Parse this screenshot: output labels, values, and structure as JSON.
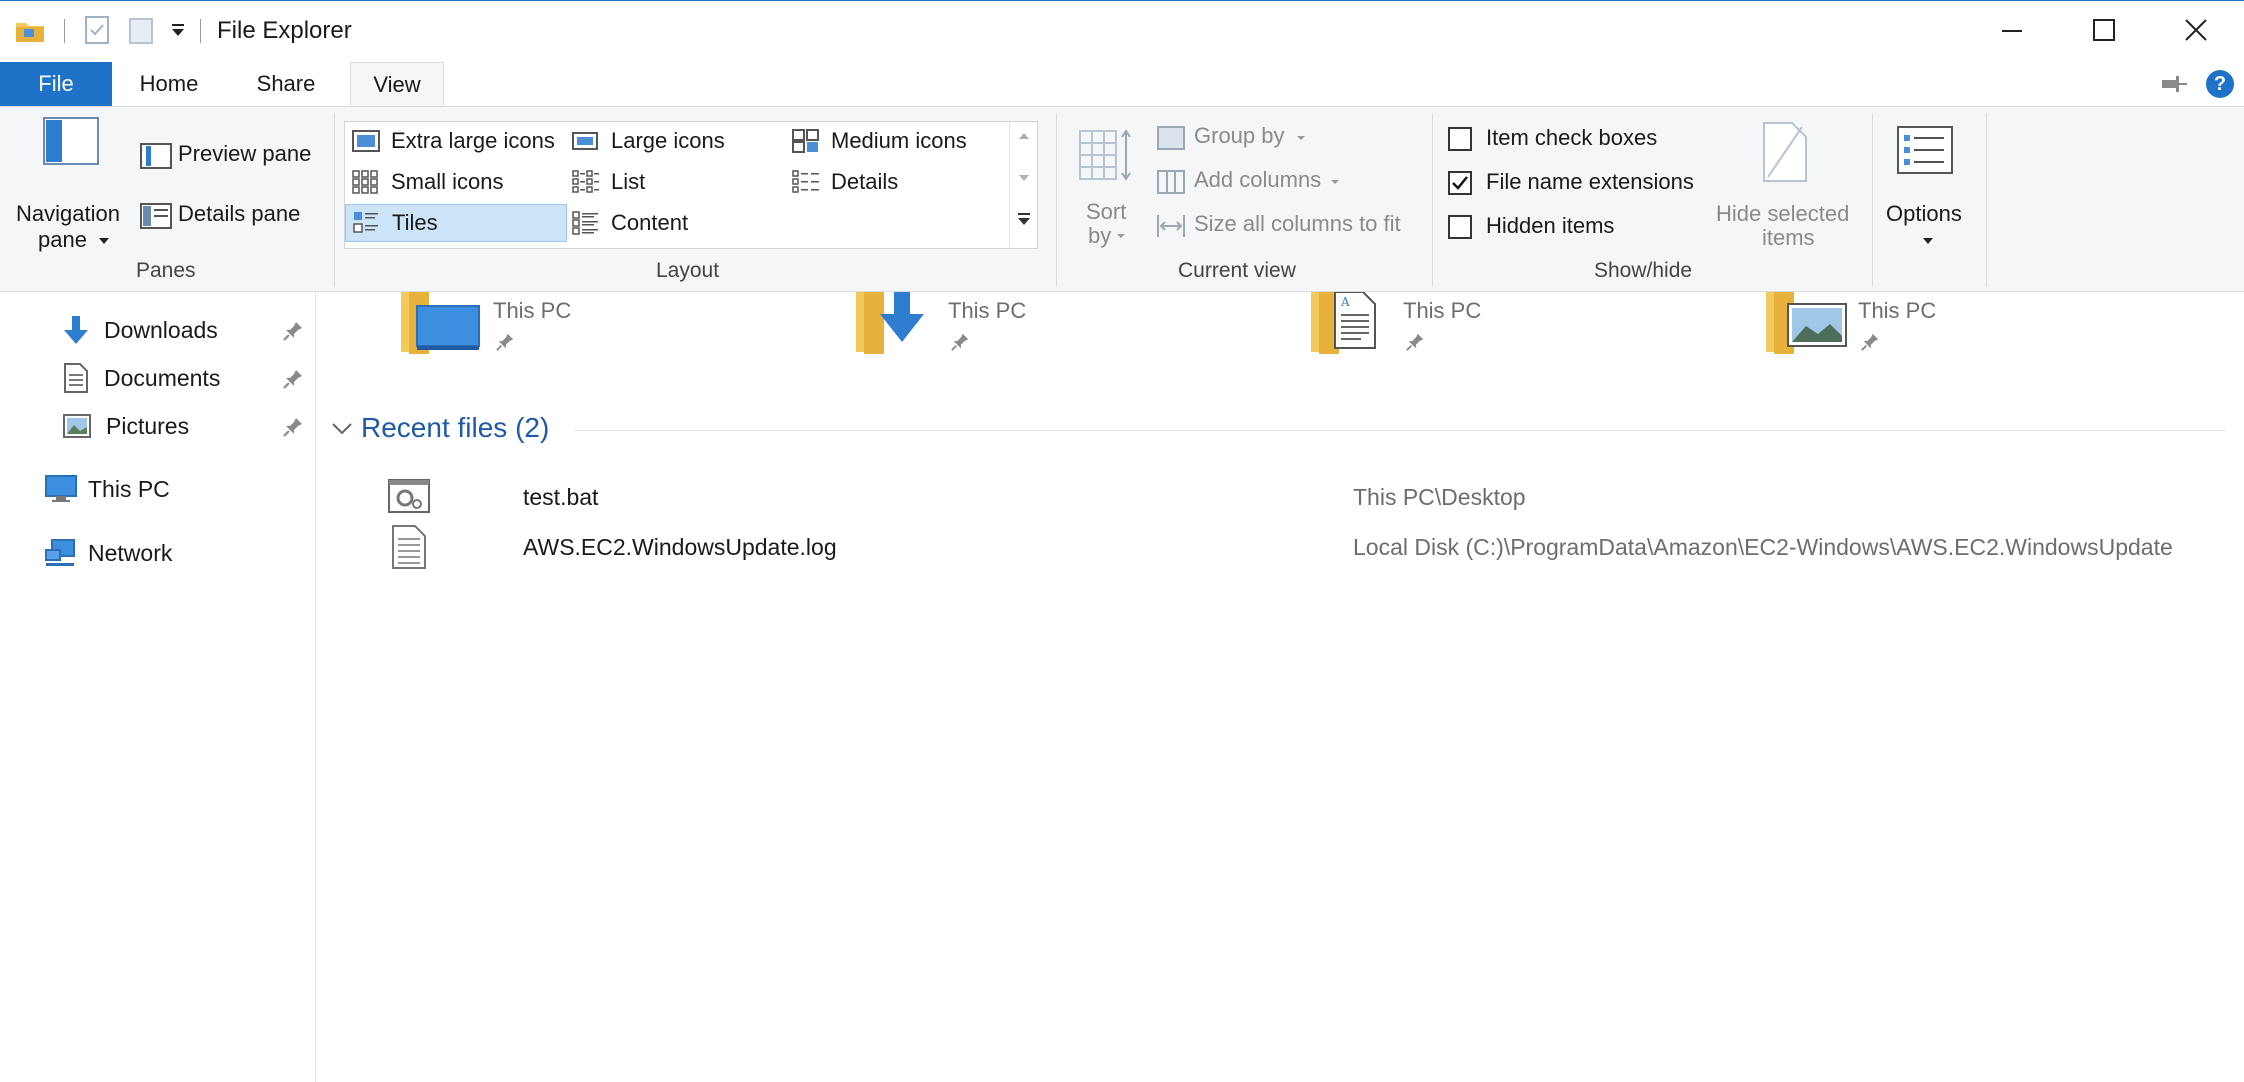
{
  "window": {
    "title": "File Explorer",
    "quick_access_toolbar": [
      "folder-icon",
      "properties-icon",
      "new-folder-icon",
      "customize-dropdown-icon"
    ],
    "controls": [
      "minimize",
      "maximize",
      "close"
    ]
  },
  "ribbon_tabs": [
    {
      "label": "File"
    },
    {
      "label": "Home"
    },
    {
      "label": "Share"
    },
    {
      "label": "View",
      "active": true
    }
  ],
  "ribbon": {
    "panes": {
      "group_label": "Panes",
      "navigation_pane_line1": "Navigation",
      "navigation_pane_line2": "pane",
      "preview_pane": "Preview pane",
      "details_pane": "Details pane"
    },
    "layout": {
      "group_label": "Layout",
      "items": [
        {
          "label": "Extra large icons"
        },
        {
          "label": "Large icons"
        },
        {
          "label": "Medium icons"
        },
        {
          "label": "Small icons"
        },
        {
          "label": "List"
        },
        {
          "label": "Details"
        },
        {
          "label": "Tiles",
          "selected": true
        },
        {
          "label": "Content"
        }
      ]
    },
    "current_view": {
      "group_label": "Current view",
      "sort_by_line1": "Sort",
      "sort_by_line2": "by",
      "group_by": "Group by",
      "add_columns": "Add columns",
      "size_all_columns": "Size all columns to fit"
    },
    "show_hide": {
      "group_label": "Show/hide",
      "item_check_boxes": {
        "label": "Item check boxes",
        "checked": false
      },
      "file_name_extensions": {
        "label": "File name extensions",
        "checked": true
      },
      "hidden_items": {
        "label": "Hidden items",
        "checked": false
      },
      "hide_selected_line1": "Hide selected",
      "hide_selected_line2": "items"
    },
    "options": {
      "label": "Options"
    }
  },
  "nav_pane": {
    "items": [
      {
        "label": "Downloads",
        "pinned": true
      },
      {
        "label": "Documents",
        "pinned": true
      },
      {
        "label": "Pictures",
        "pinned": true
      },
      {
        "label": "This PC"
      },
      {
        "label": "Network"
      }
    ]
  },
  "quick_access_tiles": [
    {
      "location": "This PC",
      "icon": "desktop-folder-icon"
    },
    {
      "location": "This PC",
      "icon": "downloads-folder-icon"
    },
    {
      "location": "This PC",
      "icon": "documents-folder-icon"
    },
    {
      "location": "This PC",
      "icon": "pictures-folder-icon"
    }
  ],
  "recent_files": {
    "title": "Recent files (2)",
    "items": [
      {
        "name": "test.bat",
        "location": "This PC\\Desktop",
        "icon": "batch-file-icon"
      },
      {
        "name": "AWS.EC2.WindowsUpdate.log",
        "location": "Local Disk (C:)\\ProgramData\\Amazon\\EC2-Windows\\AWS.EC2.WindowsUpdate",
        "icon": "text-file-icon"
      }
    ]
  },
  "colors": {
    "accent": "#1e72c8",
    "ribbon_bg": "#f5f6f7",
    "selected_bg": "#cce4f7",
    "section_title": "#1e5aa8"
  }
}
